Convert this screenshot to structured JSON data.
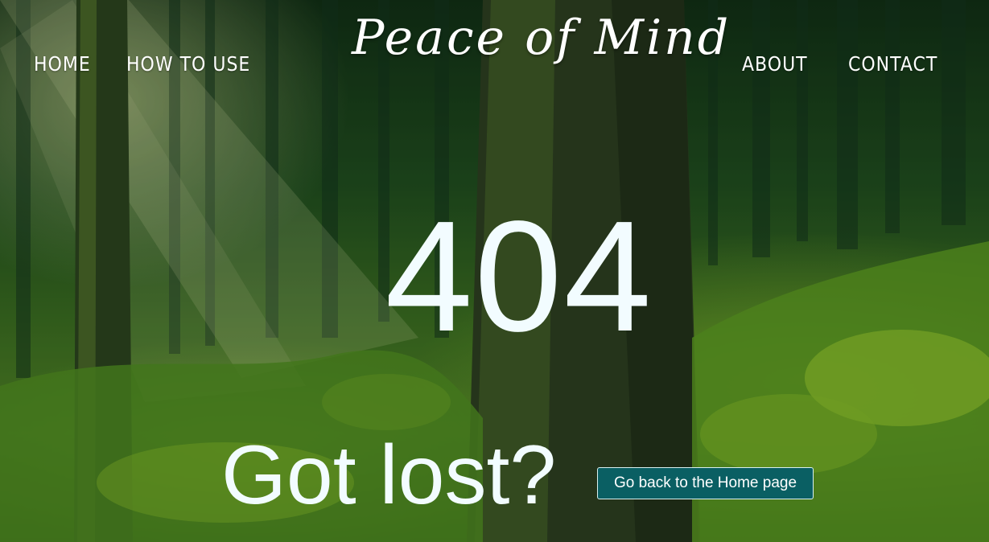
{
  "nav": {
    "home": "HOME",
    "how_to_use": "HOW TO USE",
    "about": "ABOUT",
    "contact": "CONTACT"
  },
  "site_title": "Peace of Mind",
  "error": {
    "code": "404",
    "message": "Got lost?",
    "button_label": "Go back to the Home page"
  },
  "colors": {
    "button_bg": "#0a5f63",
    "text": "#f2fcff"
  }
}
